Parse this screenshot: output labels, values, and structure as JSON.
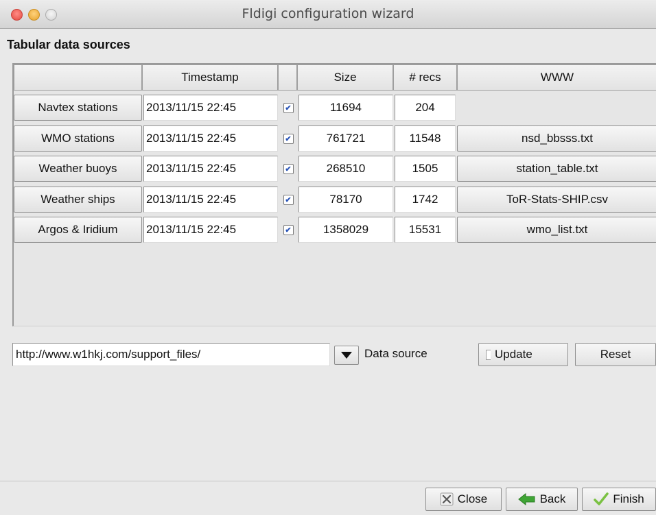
{
  "window": {
    "title": "Fldigi configuration wizard"
  },
  "section": {
    "label": "Tabular data sources"
  },
  "table": {
    "headers": {
      "timestamp": "Timestamp",
      "size": "Size",
      "recs": "# recs",
      "www": "WWW"
    },
    "rows": [
      {
        "name": "Navtex stations",
        "timestamp": "2013/11/15 22:45",
        "checked": true,
        "size": "11694",
        "recs": "204",
        "www": ""
      },
      {
        "name": "WMO stations",
        "timestamp": "2013/11/15 22:45",
        "checked": true,
        "size": "761721",
        "recs": "11548",
        "www": "nsd_bbsss.txt"
      },
      {
        "name": "Weather buoys",
        "timestamp": "2013/11/15 22:45",
        "checked": true,
        "size": "268510",
        "recs": "1505",
        "www": "station_table.txt"
      },
      {
        "name": "Weather ships",
        "timestamp": "2013/11/15 22:45",
        "checked": true,
        "size": "78170",
        "recs": "1742",
        "www": "ToR-Stats-SHIP.csv"
      },
      {
        "name": "Argos & Iridium",
        "timestamp": "2013/11/15 22:45",
        "checked": true,
        "size": "1358029",
        "recs": "15531",
        "www": "wmo_list.txt"
      }
    ]
  },
  "data_source": {
    "url": "http://www.w1hkj.com/support_files/",
    "label": "Data source",
    "update_label": "Update",
    "reset_label": "Reset"
  },
  "footer": {
    "close_label": "Close",
    "back_label": "Back",
    "finish_label": "Finish"
  },
  "colors": {
    "back_arrow": "#3fa535",
    "finish_check": "#7ac142"
  },
  "icons": {
    "check": "✔"
  }
}
